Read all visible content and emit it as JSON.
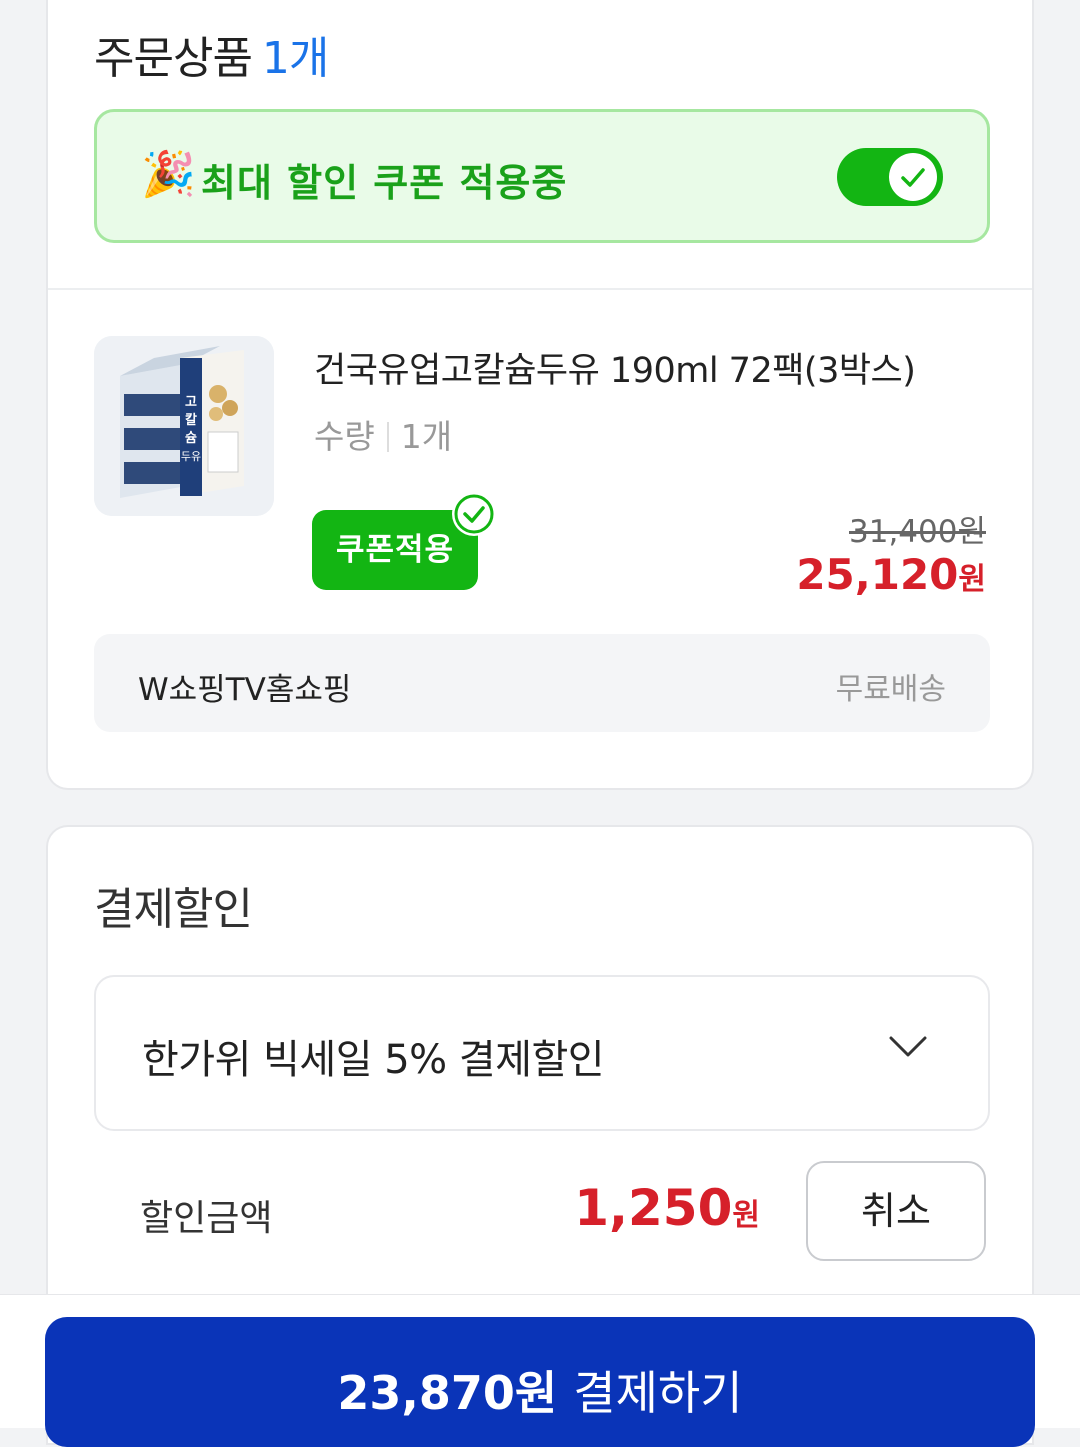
{
  "order": {
    "title": "주문상품",
    "count": "1개",
    "coupon_banner": {
      "text": "최대 할인 쿠폰 적용중",
      "toggle_on": true,
      "accent": "#13b513"
    },
    "item": {
      "name": "건국유업고칼슘두유 190ml 72팩(3박스)",
      "qty_label": "수량",
      "qty_value": "1개",
      "coupon_chip": "쿠폰적용",
      "original_price": "31,400원",
      "sale_price": "25,120",
      "sale_price_unit": "원",
      "image_icon": "product-soymilk-box-image",
      "package_text": "고칼슘두유"
    },
    "seller": {
      "name": "W쇼핑TV홈쇼핑",
      "shipping": "무료배송"
    }
  },
  "payment_discount": {
    "title": "결제할인",
    "selected_option": "한가위 빅세일 5% 결제할인",
    "discount_label": "할인금액",
    "discount_amount": "1,250",
    "discount_unit": "원",
    "cancel_label": "취소"
  },
  "footer": {
    "pay_amount": "23,870원",
    "pay_label": "결제하기",
    "button_color": "#0a34b8"
  }
}
